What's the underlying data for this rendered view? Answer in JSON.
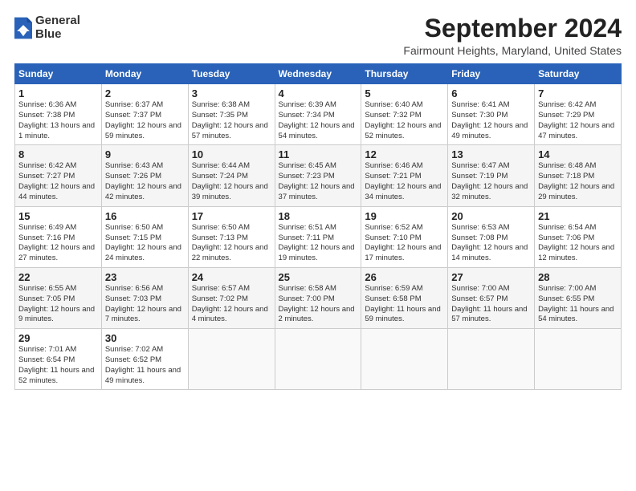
{
  "header": {
    "logo_line1": "General",
    "logo_line2": "Blue",
    "month": "September 2024",
    "location": "Fairmount Heights, Maryland, United States"
  },
  "weekdays": [
    "Sunday",
    "Monday",
    "Tuesday",
    "Wednesday",
    "Thursday",
    "Friday",
    "Saturday"
  ],
  "weeks": [
    [
      {
        "day": "1",
        "sunrise": "6:36 AM",
        "sunset": "7:38 PM",
        "daylight": "13 hours and 1 minute."
      },
      {
        "day": "2",
        "sunrise": "6:37 AM",
        "sunset": "7:37 PM",
        "daylight": "12 hours and 59 minutes."
      },
      {
        "day": "3",
        "sunrise": "6:38 AM",
        "sunset": "7:35 PM",
        "daylight": "12 hours and 57 minutes."
      },
      {
        "day": "4",
        "sunrise": "6:39 AM",
        "sunset": "7:34 PM",
        "daylight": "12 hours and 54 minutes."
      },
      {
        "day": "5",
        "sunrise": "6:40 AM",
        "sunset": "7:32 PM",
        "daylight": "12 hours and 52 minutes."
      },
      {
        "day": "6",
        "sunrise": "6:41 AM",
        "sunset": "7:30 PM",
        "daylight": "12 hours and 49 minutes."
      },
      {
        "day": "7",
        "sunrise": "6:42 AM",
        "sunset": "7:29 PM",
        "daylight": "12 hours and 47 minutes."
      }
    ],
    [
      {
        "day": "8",
        "sunrise": "6:42 AM",
        "sunset": "7:27 PM",
        "daylight": "12 hours and 44 minutes."
      },
      {
        "day": "9",
        "sunrise": "6:43 AM",
        "sunset": "7:26 PM",
        "daylight": "12 hours and 42 minutes."
      },
      {
        "day": "10",
        "sunrise": "6:44 AM",
        "sunset": "7:24 PM",
        "daylight": "12 hours and 39 minutes."
      },
      {
        "day": "11",
        "sunrise": "6:45 AM",
        "sunset": "7:23 PM",
        "daylight": "12 hours and 37 minutes."
      },
      {
        "day": "12",
        "sunrise": "6:46 AM",
        "sunset": "7:21 PM",
        "daylight": "12 hours and 34 minutes."
      },
      {
        "day": "13",
        "sunrise": "6:47 AM",
        "sunset": "7:19 PM",
        "daylight": "12 hours and 32 minutes."
      },
      {
        "day": "14",
        "sunrise": "6:48 AM",
        "sunset": "7:18 PM",
        "daylight": "12 hours and 29 minutes."
      }
    ],
    [
      {
        "day": "15",
        "sunrise": "6:49 AM",
        "sunset": "7:16 PM",
        "daylight": "12 hours and 27 minutes."
      },
      {
        "day": "16",
        "sunrise": "6:50 AM",
        "sunset": "7:15 PM",
        "daylight": "12 hours and 24 minutes."
      },
      {
        "day": "17",
        "sunrise": "6:50 AM",
        "sunset": "7:13 PM",
        "daylight": "12 hours and 22 minutes."
      },
      {
        "day": "18",
        "sunrise": "6:51 AM",
        "sunset": "7:11 PM",
        "daylight": "12 hours and 19 minutes."
      },
      {
        "day": "19",
        "sunrise": "6:52 AM",
        "sunset": "7:10 PM",
        "daylight": "12 hours and 17 minutes."
      },
      {
        "day": "20",
        "sunrise": "6:53 AM",
        "sunset": "7:08 PM",
        "daylight": "12 hours and 14 minutes."
      },
      {
        "day": "21",
        "sunrise": "6:54 AM",
        "sunset": "7:06 PM",
        "daylight": "12 hours and 12 minutes."
      }
    ],
    [
      {
        "day": "22",
        "sunrise": "6:55 AM",
        "sunset": "7:05 PM",
        "daylight": "12 hours and 9 minutes."
      },
      {
        "day": "23",
        "sunrise": "6:56 AM",
        "sunset": "7:03 PM",
        "daylight": "12 hours and 7 minutes."
      },
      {
        "day": "24",
        "sunrise": "6:57 AM",
        "sunset": "7:02 PM",
        "daylight": "12 hours and 4 minutes."
      },
      {
        "day": "25",
        "sunrise": "6:58 AM",
        "sunset": "7:00 PM",
        "daylight": "12 hours and 2 minutes."
      },
      {
        "day": "26",
        "sunrise": "6:59 AM",
        "sunset": "6:58 PM",
        "daylight": "11 hours and 59 minutes."
      },
      {
        "day": "27",
        "sunrise": "7:00 AM",
        "sunset": "6:57 PM",
        "daylight": "11 hours and 57 minutes."
      },
      {
        "day": "28",
        "sunrise": "7:00 AM",
        "sunset": "6:55 PM",
        "daylight": "11 hours and 54 minutes."
      }
    ],
    [
      {
        "day": "29",
        "sunrise": "7:01 AM",
        "sunset": "6:54 PM",
        "daylight": "11 hours and 52 minutes."
      },
      {
        "day": "30",
        "sunrise": "7:02 AM",
        "sunset": "6:52 PM",
        "daylight": "11 hours and 49 minutes."
      },
      null,
      null,
      null,
      null,
      null
    ]
  ]
}
